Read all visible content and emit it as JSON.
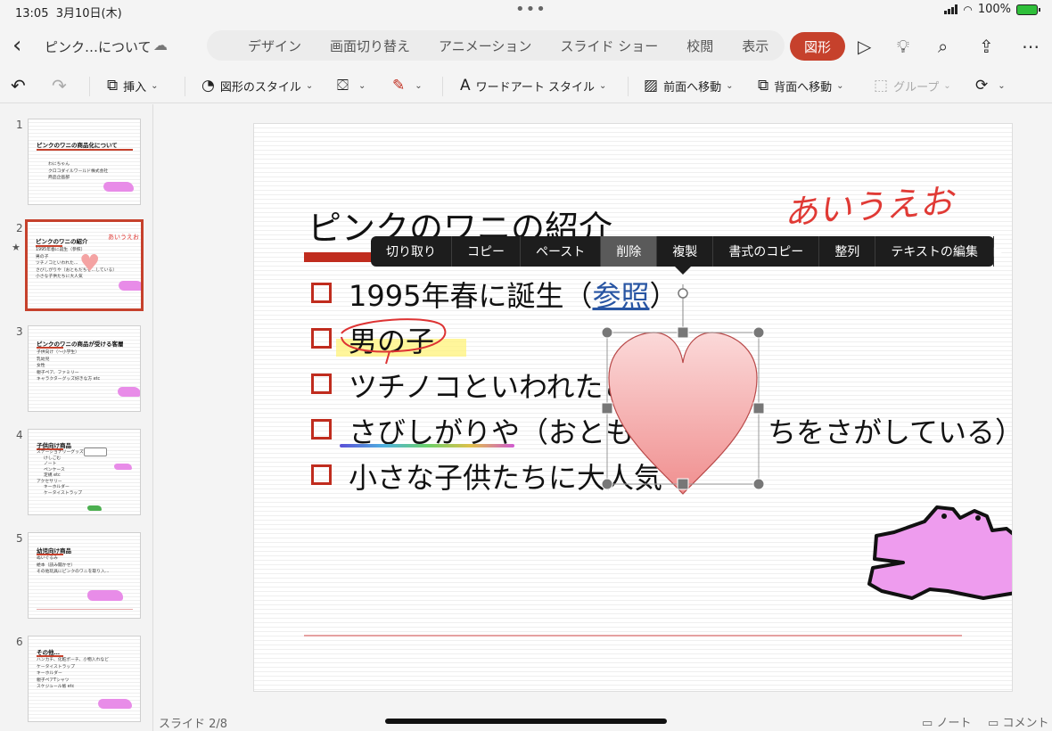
{
  "status": {
    "time": "13:05",
    "date": "3月10日(木)",
    "battery": "100%"
  },
  "tabrow": {
    "doc_title": "ピンク…について",
    "tabs": [
      "デザイン",
      "画面切り替え",
      "アニメーション",
      "スライド ショー",
      "校閲",
      "表示"
    ],
    "active_tab": "図形"
  },
  "ribbon": {
    "insert": "挿入",
    "shape_style": "図形のスタイル",
    "wordart_style": "ワードアート スタイル",
    "bring_forward": "前面へ移動",
    "send_backward": "背面へ移動",
    "group": "グループ"
  },
  "thumbnails": [
    {
      "num": "1",
      "title": "ピンクのワニの商品化について",
      "lines": [
        "わにちゃん",
        "クロコダイルワールド株式会社",
        "商品企画部"
      ]
    },
    {
      "num": "2",
      "title": "ピンクのワニの紹介",
      "lines": [
        "1995年春に誕生（参照）",
        "男の子",
        "ツチノコといわれた…",
        "さびしがりや（おともだちを…している）",
        "小さな子供たちに大人気"
      ],
      "hand": "あいうえお"
    },
    {
      "num": "3",
      "title": "ピンクのワニの商品が受ける客層",
      "lines": [
        "子供向け（～小学生）",
        "乳幼児",
        "女性",
        "親子ペア、ファミリー",
        "キャラクターグッズ好きな方 etc"
      ]
    },
    {
      "num": "4",
      "title": "子供向け商品",
      "lines": [
        "ステーショナリーグッズ",
        "けしごむ",
        "ノート",
        "ペンケース",
        "定規 etc",
        "アクセサリー",
        "キーホルダー",
        "ケータイストラップ"
      ]
    },
    {
      "num": "5",
      "title": "幼児向け商品",
      "lines": [
        "ぬいぐるみ",
        "絵本（読み聞かせ）",
        "その他玩具にピンクのワニを取り入…"
      ]
    },
    {
      "num": "6",
      "title": "その他…",
      "lines": [
        "ハンカチ、化粧ポーチ、小物入れなど",
        "ケータイストラップ",
        "キーホルダー",
        "親子ペアTシャツ",
        "スケジュール帳 etc"
      ]
    }
  ],
  "slide": {
    "title": "ピンクのワニの紹介",
    "handwriting": "あいうえお",
    "bullet1_pre": "1995年春に誕生（",
    "bullet1_link": "参照",
    "bullet1_post": "）",
    "bullet2": "男の子",
    "bullet3": "ツチノコといわれたこ",
    "bullet4_pre": "さびしがりや（おともだ",
    "bullet4_post": "ちをさがしている）",
    "bullet5": "小さな子供たちに大人気"
  },
  "context_menu": {
    "items": [
      "切り取り",
      "コピー",
      "ペースト",
      "削除",
      "複製",
      "書式のコピー",
      "整列",
      "テキストの編集"
    ],
    "active_index": 3
  },
  "bottombar": {
    "slide_count": "スライド 2/8",
    "notes": "ノート",
    "comments": "コメント"
  },
  "colors": {
    "accent": "#c6412c",
    "bullet_red": "#c02c1e",
    "croc_pink": "#ee9cee",
    "heart_pink": "#f4a3a3"
  }
}
